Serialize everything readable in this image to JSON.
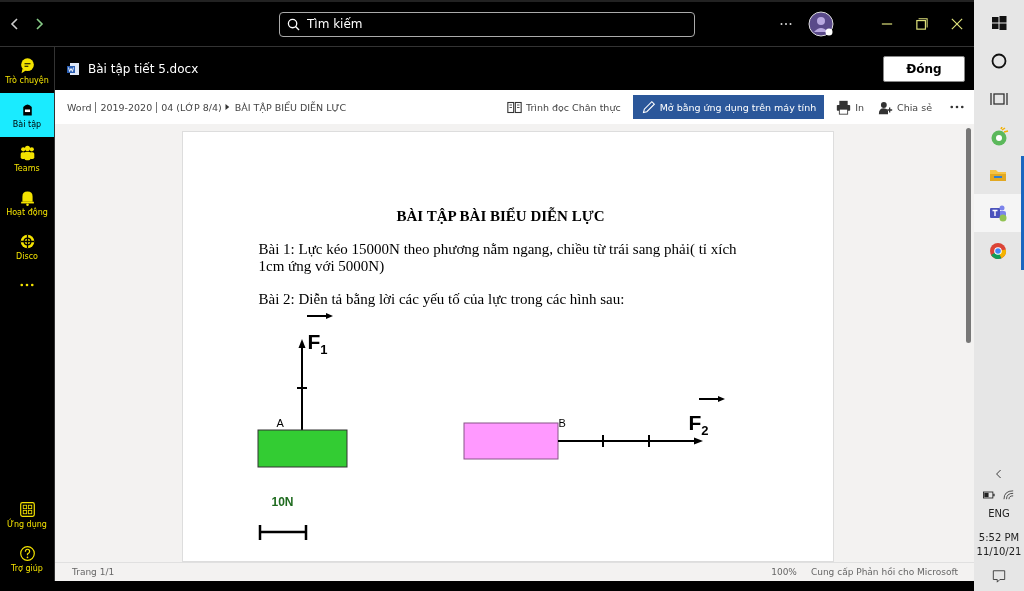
{
  "title_bar": {
    "search": {
      "placeholder": "Tìm kiếm"
    }
  },
  "sidebar": {
    "items": [
      {
        "label": "Trò chuyện",
        "kind": "chat",
        "selected": false
      },
      {
        "label": "Bài tập",
        "kind": "assignments",
        "selected": true
      },
      {
        "label": "Teams",
        "kind": "teams",
        "selected": false
      },
      {
        "label": "Hoạt động",
        "kind": "activity",
        "selected": false
      },
      {
        "label": "Disco",
        "kind": "disco",
        "selected": false
      }
    ],
    "bottom_items": [
      {
        "label": "Ứng dụng",
        "kind": "apps",
        "selected": false
      },
      {
        "label": "Trợ giúp",
        "kind": "help",
        "selected": false
      }
    ]
  },
  "document_header": {
    "file_name": "Bài tập tiết 5.docx",
    "close_button": "Đóng"
  },
  "toolbar": {
    "path": [
      "Word",
      "2019-2020",
      "04 (LỚP 8/4)"
    ],
    "current": "BÀI TẬP BIỂU DIỄN LỰC",
    "actions": [
      {
        "label": "Trình đọc Chân thực",
        "kind": "reader"
      },
      {
        "label": "Mở bằng ứng dụng trên máy tính",
        "kind": "primary"
      },
      {
        "label": "In",
        "kind": "print"
      },
      {
        "label": "Chia sẻ",
        "kind": "share"
      }
    ]
  },
  "document": {
    "title": "BÀI TẬP BÀI BIỂU DIỄN LỰC",
    "paragraphs": [
      "Bài 1: Lực kéo 15000N theo phương nằm ngang, chiều từ trái sang phải( tỉ xích 1cm ứng với 5000N)",
      "Bài 2: Diễn tả bằng lời các yếu tố của lực trong các hình sau:"
    ],
    "figure_labels": [
      {
        "text": "F$_{1}$",
        "kind": "force"
      },
      {
        "text": "A",
        "kind": "point"
      },
      {
        "text": "B",
        "kind": "point"
      },
      {
        "text": "F$_{2}$",
        "kind": "force"
      },
      {
        "text": "10N",
        "kind": "scale"
      }
    ]
  },
  "status_bar": {
    "page": "Trang 1/1",
    "zoom": "100%",
    "feedback": "Cung cấp Phản hồi cho Microsoft"
  },
  "taskbar": {
    "apps": [
      {
        "kind": "start",
        "running": false,
        "selected": false
      },
      {
        "kind": "search",
        "running": false,
        "selected": false
      },
      {
        "kind": "taskview",
        "running": false,
        "selected": false
      },
      {
        "kind": "green",
        "running": false,
        "selected": false
      },
      {
        "kind": "folder",
        "running": true,
        "selected": false
      },
      {
        "kind": "teams",
        "running": true,
        "selected": true
      },
      {
        "kind": "chrome",
        "running": true,
        "selected": false
      }
    ],
    "language": "ENG",
    "time": "5:52 PM",
    "date": "11/10/21"
  }
}
